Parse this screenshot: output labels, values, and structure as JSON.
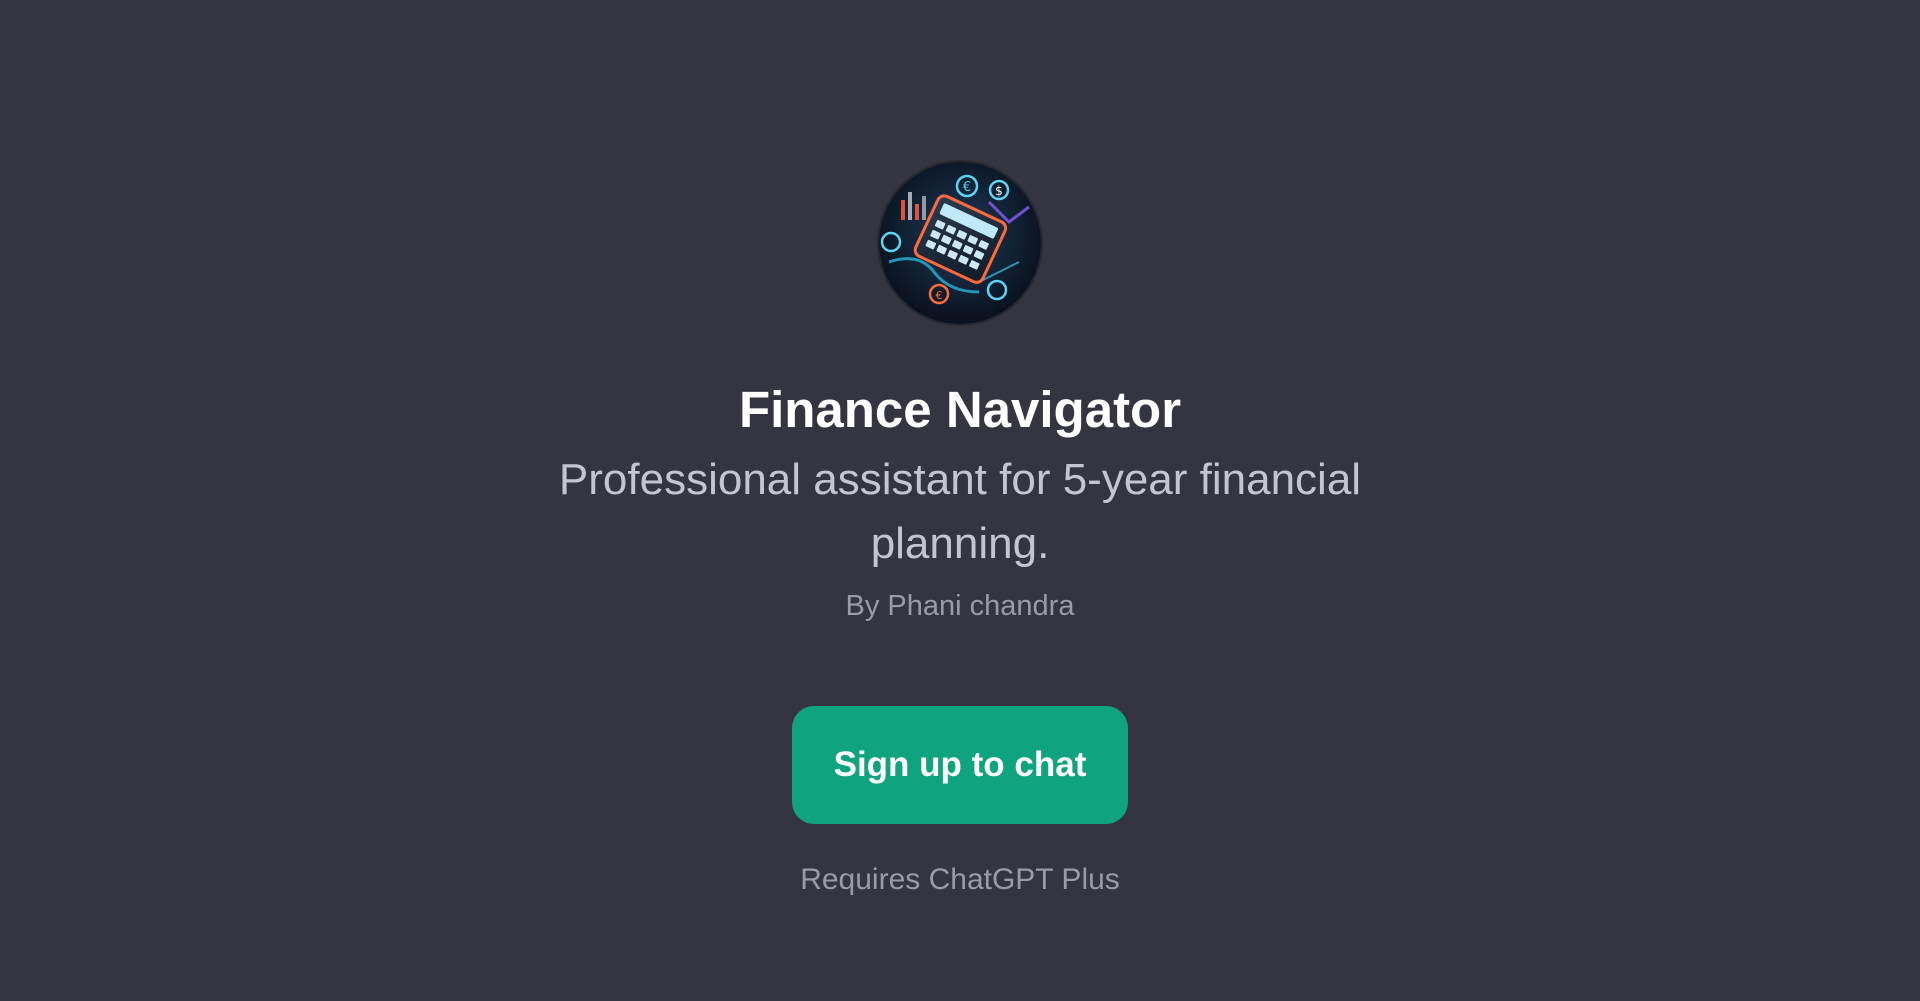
{
  "gpt": {
    "avatar_icon": "calculator-finance-icon",
    "name": "Finance Navigator",
    "description": "Professional assistant for 5-year financial planning.",
    "author": "By Phani chandra"
  },
  "cta": {
    "label": "Sign up to chat"
  },
  "footer": {
    "requirement": "Requires ChatGPT Plus"
  },
  "colors": {
    "background": "#343541",
    "accent": "#10a37f",
    "title": "#ffffff",
    "subtitle": "#c5c5d2",
    "muted": "#9a9aa8"
  }
}
